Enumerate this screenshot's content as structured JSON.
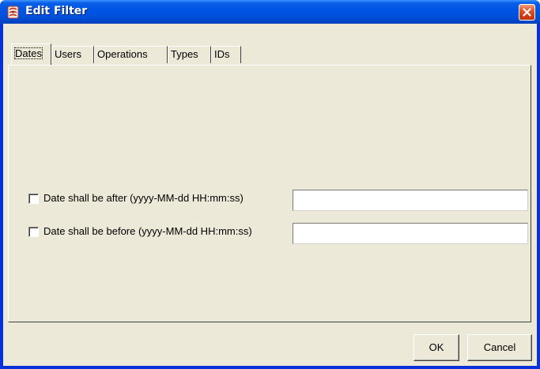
{
  "window": {
    "title": "Edit Filter",
    "icon": "app-icon",
    "close_icon": "close-icon",
    "titlebar_color": "#0055e5",
    "client_color": "#ece9d8"
  },
  "tabs": [
    {
      "label": "Dates",
      "selected": true
    },
    {
      "label": "Users",
      "selected": false
    },
    {
      "label": "Operations",
      "selected": false
    },
    {
      "label": "Types",
      "selected": false
    },
    {
      "label": "IDs",
      "selected": false
    }
  ],
  "dates": {
    "after": {
      "label": "Date shall be after (yyyy-MM-dd HH:mm:ss)",
      "checked": false,
      "value": ""
    },
    "before": {
      "label": "Date shall be before (yyyy-MM-dd HH:mm:ss)",
      "checked": false,
      "value": ""
    }
  },
  "buttons": {
    "ok_label": "OK",
    "cancel_label": "Cancel"
  }
}
